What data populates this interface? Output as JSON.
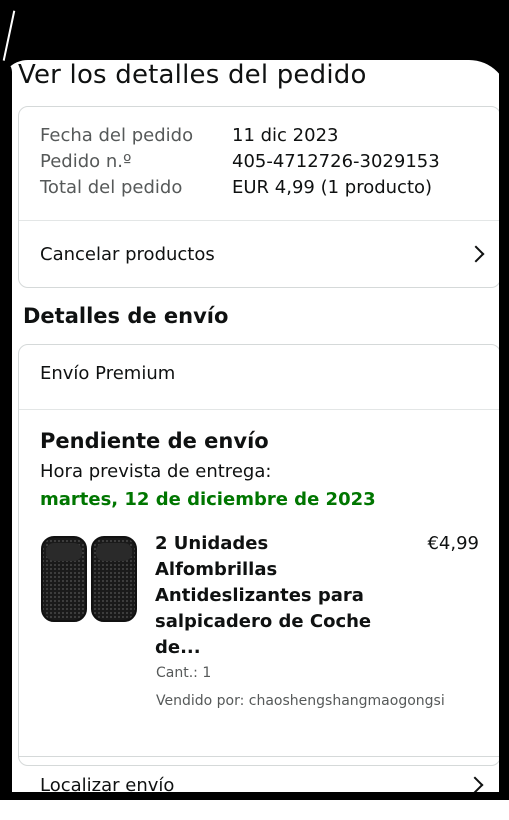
{
  "page": {
    "title": "Ver los detalles del pedido"
  },
  "order": {
    "date_label": "Fecha del pedido",
    "date_value": "11 dic 2023",
    "number_label": "Pedido n.º",
    "number_value": "405-4712726-3029153",
    "total_label": "Total del pedido",
    "total_value": "EUR 4,99 (1 producto)",
    "cancel_label": "Cancelar productos"
  },
  "shipping": {
    "section_title": "Detalles de envío",
    "method": "Envío Premium",
    "status": "Pendiente de envío",
    "eta_label": "Hora prevista de entrega:",
    "eta_date": "martes, 12 de diciembre de 2023",
    "eta_color": "#007600"
  },
  "product": {
    "title": "2 Unidades Alfombrillas Antideslizantes para salpicadero de Coche de...",
    "price": "€4,99",
    "quantity": "Cant.: 1",
    "seller": "Vendido por: chaoshengshangmaogongsi",
    "image_icon": "car-dashboard-mat-image"
  },
  "tracking": {
    "label": "Localizar envío"
  }
}
